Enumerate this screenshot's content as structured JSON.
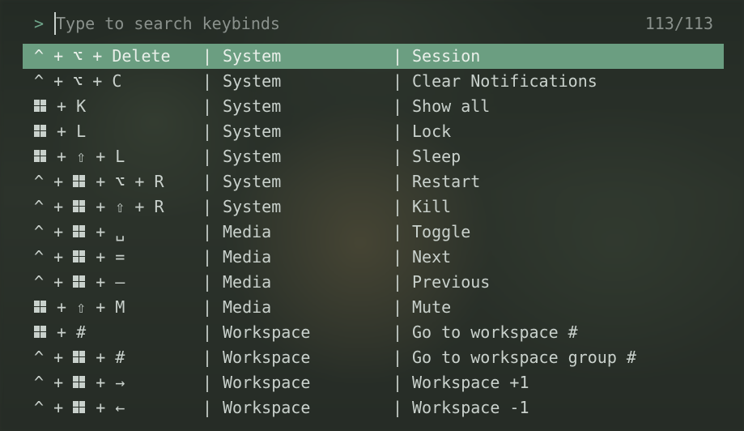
{
  "search": {
    "prompt": ">",
    "placeholder": "Type to search keybinds",
    "value": "",
    "count": "113/113"
  },
  "colors": {
    "accent": "#6fa58a",
    "selected_row": "#6b9e81"
  },
  "separator": "|",
  "rows": [
    {
      "keys": [
        "^",
        "⌥",
        "Delete"
      ],
      "category": "System",
      "action": "Session",
      "selected": true
    },
    {
      "keys": [
        "^",
        "⌥",
        "C"
      ],
      "category": "System",
      "action": "Clear Notifications"
    },
    {
      "keys": [
        "WIN",
        "K"
      ],
      "category": "System",
      "action": "Show all"
    },
    {
      "keys": [
        "WIN",
        "L"
      ],
      "category": "System",
      "action": "Lock"
    },
    {
      "keys": [
        "WIN",
        "⇧",
        "L"
      ],
      "category": "System",
      "action": "Sleep"
    },
    {
      "keys": [
        "^",
        "WIN",
        "⌥",
        "R"
      ],
      "category": "System",
      "action": "Restart"
    },
    {
      "keys": [
        "^",
        "WIN",
        "⇧",
        "R"
      ],
      "category": "System",
      "action": "Kill"
    },
    {
      "keys": [
        "^",
        "WIN",
        "␣"
      ],
      "category": "Media",
      "action": "Toggle"
    },
    {
      "keys": [
        "^",
        "WIN",
        "="
      ],
      "category": "Media",
      "action": "Next"
    },
    {
      "keys": [
        "^",
        "WIN",
        "—"
      ],
      "category": "Media",
      "action": "Previous"
    },
    {
      "keys": [
        "WIN",
        "⇧",
        "M"
      ],
      "category": "Media",
      "action": "Mute"
    },
    {
      "keys": [
        "WIN",
        "#"
      ],
      "category": "Workspace",
      "action": "Go to workspace #"
    },
    {
      "keys": [
        "^",
        "WIN",
        "#"
      ],
      "category": "Workspace",
      "action": "Go to workspace group #"
    },
    {
      "keys": [
        "^",
        "WIN",
        "→"
      ],
      "category": "Workspace",
      "action": "Workspace +1"
    },
    {
      "keys": [
        "^",
        "WIN",
        "←"
      ],
      "category": "Workspace",
      "action": "Workspace -1"
    }
  ]
}
